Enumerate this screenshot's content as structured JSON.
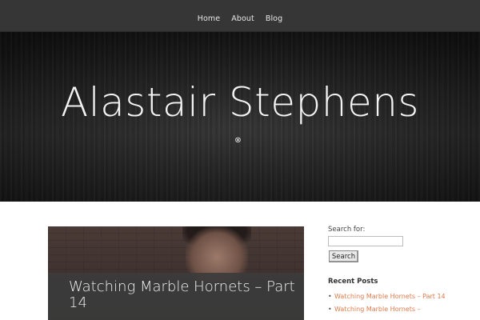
{
  "nav": {
    "items": [
      {
        "label": "Home"
      },
      {
        "label": "About"
      },
      {
        "label": "Blog"
      }
    ]
  },
  "hero": {
    "site_title": "Alastair Stephens",
    "scroll_icon": "⊗",
    "icon_name": "scroll-down-icon"
  },
  "post": {
    "title": "Watching Marble Hornets – Part 14"
  },
  "sidebar": {
    "search_label": "Search for:",
    "search_value": "",
    "search_button": "Search",
    "recent_heading": "Recent Posts",
    "recent_posts": [
      {
        "label": "Watching Marble Hornets – Part 14"
      },
      {
        "label": "Watching Marble Hornets –"
      }
    ]
  },
  "colors": {
    "nav_bg": "#363636",
    "link_accent": "#e07a4b",
    "title_bar_bg": "#3c3c3c"
  }
}
